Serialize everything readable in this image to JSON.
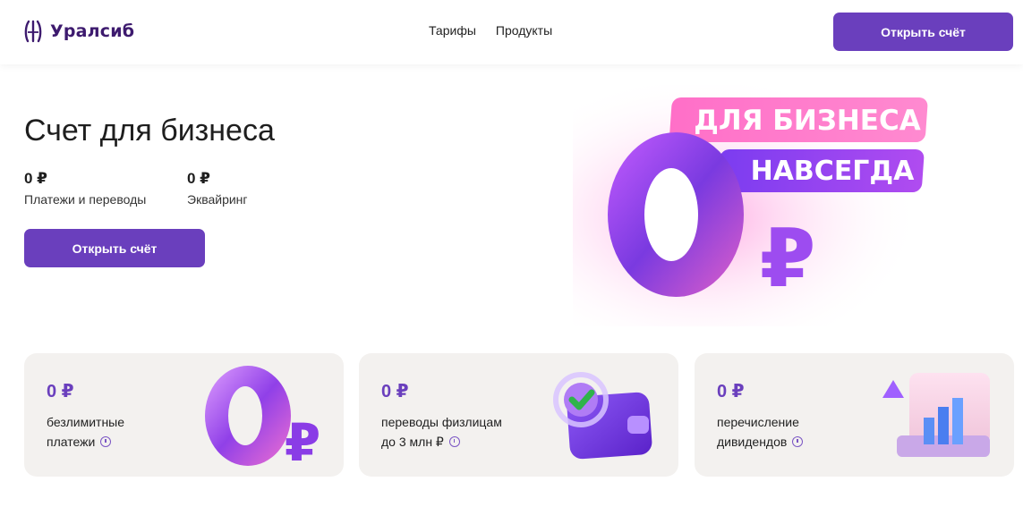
{
  "header": {
    "logo_text": "Уралсиб",
    "nav": [
      "Тарифы",
      "Продукты"
    ],
    "cta_label": "Открыть счёт"
  },
  "hero": {
    "title": "Счет для бизнеса",
    "stats": [
      {
        "value": "0 ₽",
        "label": "Платежи и переводы"
      },
      {
        "value": "0 ₽",
        "label": "Эквайринг"
      }
    ],
    "cta_label": "Открыть счёт",
    "art_line1": "ДЛЯ БИЗНЕСА",
    "art_line2": "НАВСЕГДА",
    "art_big": "0₽"
  },
  "cards": [
    {
      "value": "0 ₽",
      "line1": "безлимитные",
      "line2": "платежи",
      "art": "zero-ruble-3d-icon"
    },
    {
      "value": "0 ₽",
      "line1": "переводы физлицам",
      "line2": "до 3 млн ₽",
      "art": "wallet-check-icon"
    },
    {
      "value": "0 ₽",
      "line1": "перечисление",
      "line2": "дивидендов",
      "art": "growth-chart-case-icon"
    }
  ],
  "colors": {
    "accent": "#6a3fbd",
    "card_bg": "#f3f1ef",
    "logo": "#3d1a6e"
  }
}
